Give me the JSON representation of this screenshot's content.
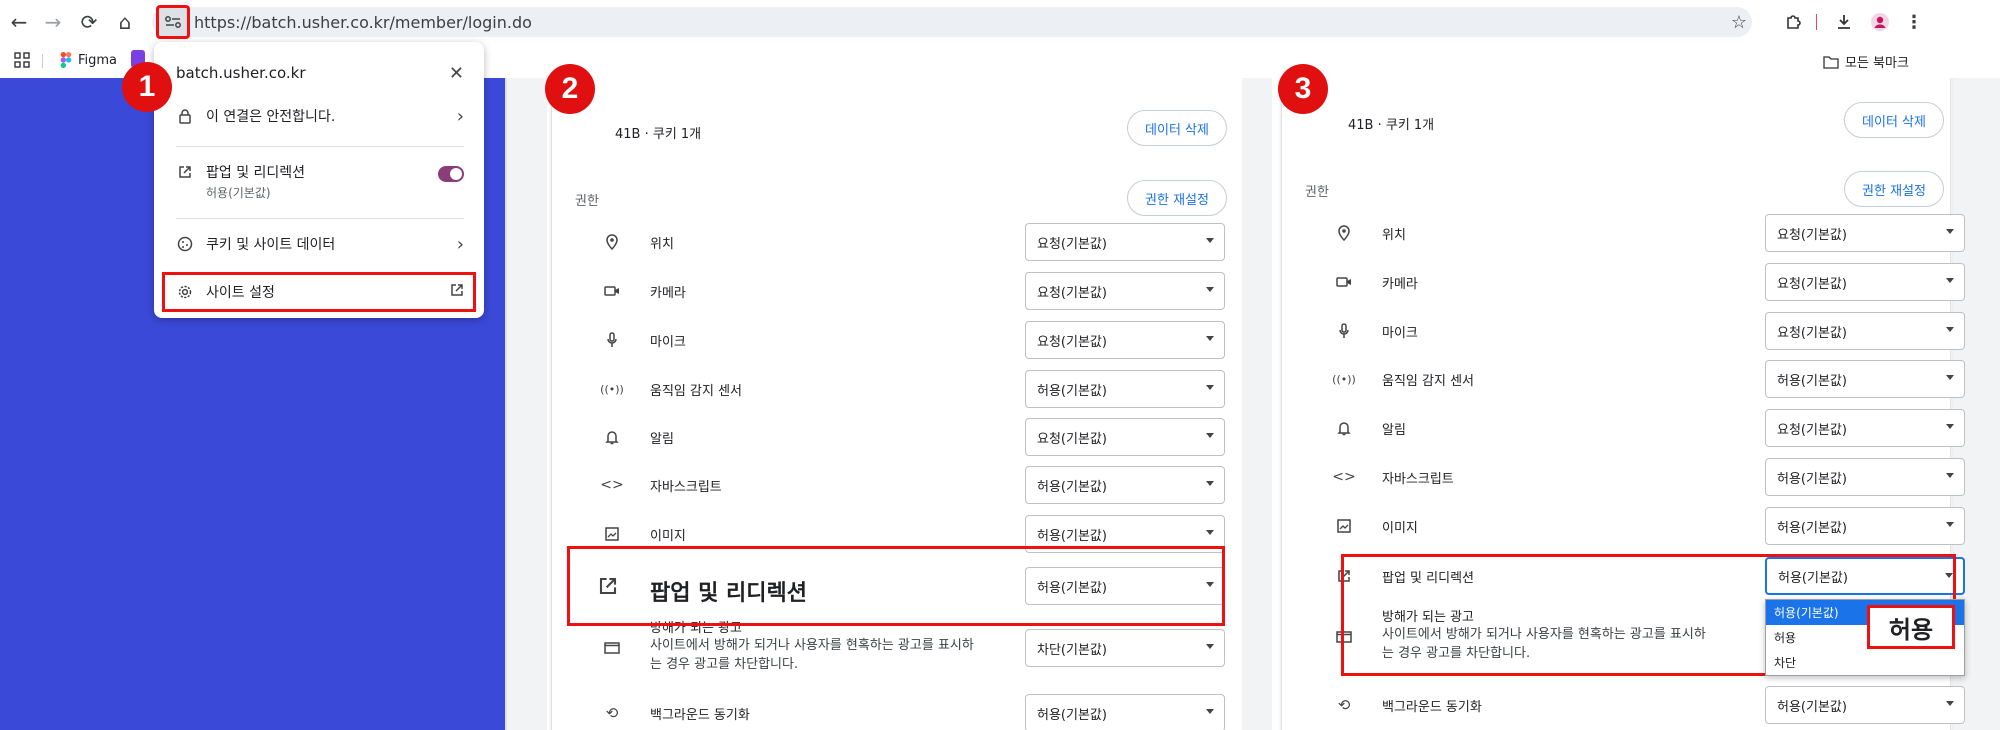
{
  "browser": {
    "url": "https://batch.usher.co.kr/member/login.do",
    "bookmarks": {
      "figma_label": "Figma",
      "all_bookmarks_label": "모든 북마크"
    }
  },
  "popup": {
    "site": "batch.usher.co.kr",
    "connection_label": "이 연결은 안전합니다.",
    "popups_label": "팝업 및 리디렉션",
    "popups_status": "허용(기본값)",
    "cookies_label": "쿠키 및 사이트 데이터",
    "site_settings_label": "사이트 설정"
  },
  "markers": [
    "1",
    "2",
    "3"
  ],
  "panel2": {
    "usage_text": "41B · 쿠키 1개",
    "delete_data_label": "데이터 삭제",
    "permissions_label": "권한",
    "reset_permissions_label": "권한 재설정",
    "rows": [
      {
        "label": "위치",
        "value": "요청(기본값)"
      },
      {
        "label": "카메라",
        "value": "요청(기본값)"
      },
      {
        "label": "마이크",
        "value": "요청(기본값)"
      },
      {
        "label": "움직임 감지 센서",
        "value": "허용(기본값)"
      },
      {
        "label": "알림",
        "value": "요청(기본값)"
      },
      {
        "label": "자바스크립트",
        "value": "허용(기본값)"
      },
      {
        "label": "이미지",
        "value": "허용(기본값)"
      },
      {
        "label": "팝업 및 리디렉션",
        "value": "허용(기본값)"
      },
      {
        "label": "방해가 되는 광고",
        "value": "차단(기본값)"
      },
      {
        "label": "백그라운드 동기화",
        "value": "허용(기본값)"
      }
    ],
    "ads_desc_line1": "사이트에서 방해가 되거나 사용자를 현혹하는 광고를 표시하",
    "ads_desc_line2": "는 경우 광고를 차단합니다."
  },
  "panel3": {
    "usage_text": "41B · 쿠키 1개",
    "delete_data_label": "데이터 삭제",
    "permissions_label": "권한",
    "reset_permissions_label": "권한 재설정",
    "rows": [
      {
        "label": "위치",
        "value": "요청(기본값)"
      },
      {
        "label": "카메라",
        "value": "요청(기본값)"
      },
      {
        "label": "마이크",
        "value": "요청(기본값)"
      },
      {
        "label": "움직임 감지 센서",
        "value": "허용(기본값)"
      },
      {
        "label": "알림",
        "value": "요청(기본값)"
      },
      {
        "label": "자바스크립트",
        "value": "허용(기본값)"
      },
      {
        "label": "이미지",
        "value": "허용(기본값)"
      },
      {
        "label": "팝업 및 리디렉션",
        "value": "허용(기본값)"
      },
      {
        "label": "방해가 되는 광고",
        "value": ""
      },
      {
        "label": "백그라운드 동기화",
        "value": "허용(기본값)"
      }
    ],
    "ads_desc_line1": "사이트에서 방해가 되거나 사용자를 현혹하는 광고를 표시하",
    "ads_desc_line2": "는 경우 광고를 차단합니다.",
    "dropdown_options": [
      "허용(기본값)",
      "허용",
      "차단"
    ],
    "callout_label": "허용"
  },
  "colors": {
    "accent_blue": "#1a73e8",
    "highlight_red": "#e11111",
    "page_blue": "#3a49d8",
    "toggle_purple": "#8a3d7a"
  },
  "icons": [
    "back-icon",
    "forward-icon",
    "reload-icon",
    "home-icon",
    "site-info-icon",
    "star-icon",
    "extensions-icon",
    "download-icon",
    "profile-icon",
    "menu-icon",
    "apps-icon",
    "folder-icon",
    "lock-icon",
    "open-external-icon",
    "cookie-icon",
    "gear-icon",
    "location-icon",
    "camera-icon",
    "mic-icon",
    "sensor-icon",
    "bell-icon",
    "code-icon",
    "image-icon",
    "ad-icon",
    "sync-icon"
  ]
}
